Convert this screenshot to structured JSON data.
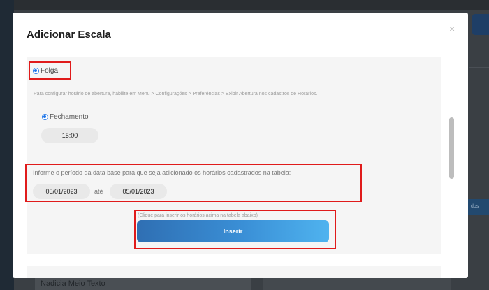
{
  "modal": {
    "title": "Adicionar Escala",
    "close": "×"
  },
  "folga": {
    "label": "Folga",
    "selected": true
  },
  "hint": "Para configurar horário de abertura, habilite em Menu > Configurações > Preferências > Exibir Abertura nos cadastros de Horários.",
  "fechamento": {
    "label": "Fechamento",
    "selected": true,
    "time": "15:00"
  },
  "period": {
    "label": "Informe o período da data base para que seja adicionado os horários cadastrados na tabela:",
    "start": "05/01/2023",
    "separator": "até",
    "end": "05/01/2023"
  },
  "insert": {
    "hint": "(Clique para inserir os horários acima na tabela abaixo)",
    "button": "Inserir"
  },
  "background": {
    "bottom_text": "Nadicia Meio Texto",
    "right_pill": "dos"
  },
  "colors": {
    "highlight_border": "#e01b1b",
    "radio": "#1a73e8",
    "button_gradient_start": "#2f6fb3",
    "button_gradient_end": "#4fb3ef"
  }
}
